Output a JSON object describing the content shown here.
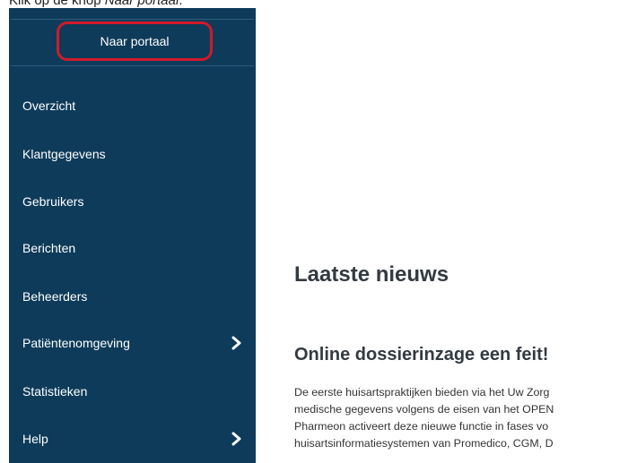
{
  "caption": {
    "prefix": "Klik op de knop ",
    "emphasis": "Naar portaal",
    "suffix": "."
  },
  "sidebar": {
    "portal_button": "Naar portaal",
    "items": [
      {
        "label": "Overzicht"
      },
      {
        "label": "Klantgegevens"
      },
      {
        "label": "Gebruikers"
      },
      {
        "label": "Berichten"
      },
      {
        "label": "Beheerders"
      },
      {
        "label": "Patiëntenomgeving",
        "icon": "chevron-right-icon"
      },
      {
        "label": "Statistieken"
      },
      {
        "label": "Help",
        "icon": "chevron-right-icon"
      }
    ]
  },
  "main": {
    "news_heading": "Laatste nieuws",
    "article": {
      "title": "Online dossierinzage een feit!",
      "lines": [
        "De eerste huisartspraktijken bieden via het Uw Zorg",
        "medische gegevens volgens de eisen van het OPEN",
        "Pharmeon activeert deze nieuwe functie in fases vo",
        "huisartsinformatiesystemen van Promedico, CGM, D"
      ]
    }
  },
  "colors": {
    "sidebar_bg": "#0e3b5a",
    "highlight": "#d11a2a"
  }
}
